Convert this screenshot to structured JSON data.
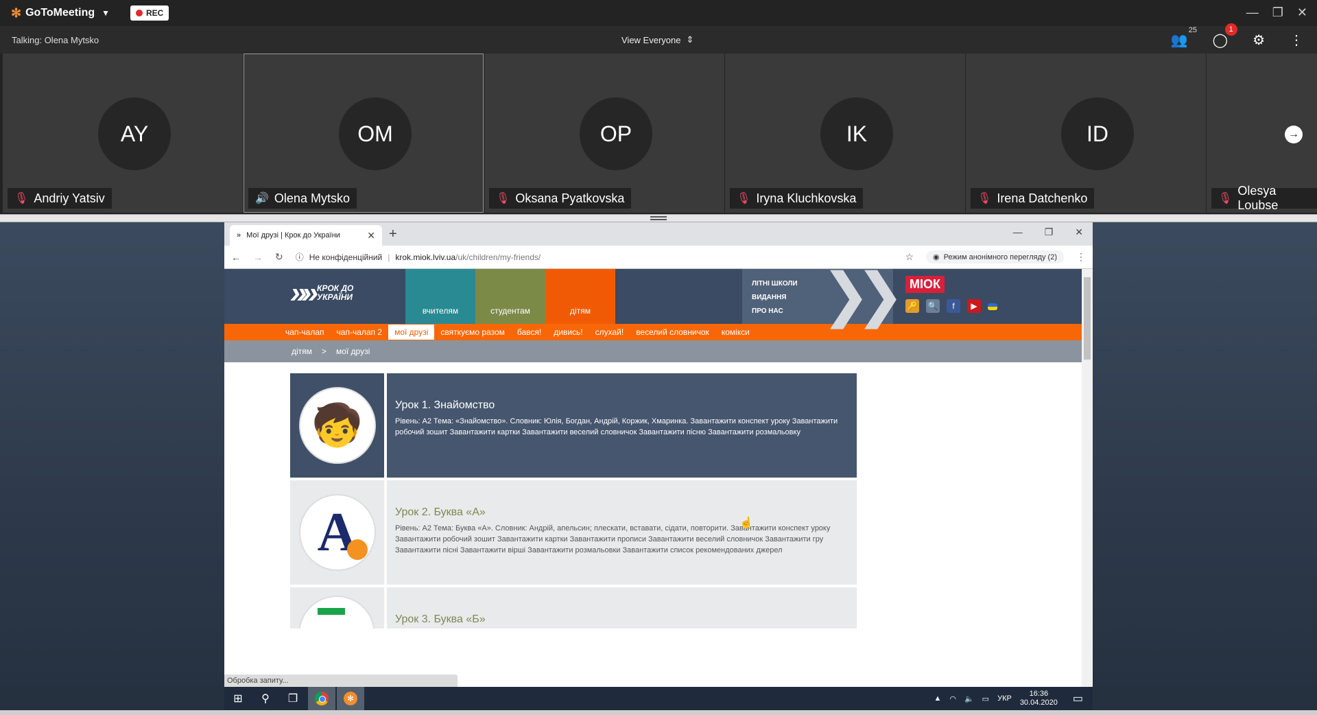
{
  "goto": {
    "brand": "GoToMeeting",
    "rec_label": "REC",
    "talking": "Talking: Olena Mytsko",
    "view_selector": "View Everyone",
    "attendee_count": "25",
    "chat_badge": "1"
  },
  "participants": [
    {
      "initials": "AY",
      "name": "Andriy Yatsiv",
      "mic": "muted"
    },
    {
      "initials": "OM",
      "name": "Olena Mytsko",
      "mic": "speaking"
    },
    {
      "initials": "OP",
      "name": "Oksana Pyatkovska",
      "mic": "muted"
    },
    {
      "initials": "IK",
      "name": "Iryna Kluchkovska",
      "mic": "muted"
    },
    {
      "initials": "ID",
      "name": "Irena Datchenko",
      "mic": "muted"
    },
    {
      "initials": "",
      "name": "Olesya Loubse",
      "mic": "muted"
    }
  ],
  "browser": {
    "tab_title": "Мої друзі | Крок до України",
    "not_secure": "Не конфіденційний",
    "url_domain": "krok.miok.lviv.ua",
    "url_path": "/uk/children/my-friends/",
    "incognito": "Режим анонімного перегляду (2)",
    "status": "Обробка запиту..."
  },
  "site": {
    "logo_text": "КРОК ДО УКРАЇНИ",
    "sections": [
      "вчителям",
      "студентам",
      "дітям"
    ],
    "header_links": [
      "ЛІТНІ ШКОЛИ",
      "ВИДАННЯ",
      "ПРО НАС"
    ],
    "miok": "МІОК",
    "menu": [
      "чап-чалап",
      "чап-чалап 2",
      "мої друзі",
      "святкуємо разом",
      "бався!",
      "дивись!",
      "слухай!",
      "веселий словничок",
      "комікси"
    ],
    "active_menu": "мої друзі",
    "breadcrumb": [
      "дітям",
      ">",
      "мої друзі"
    ],
    "lessons": [
      {
        "title": "Урок 1. Знайомство",
        "desc": "Рівень: А2 Тема: «Знайомство». Словник: Юлія, Богдан, Андрій, Коржик, Хмаринка. Завантажити конспект уроку Завантажити робочий зошит Завантажити картки Завантажити веселий словничок Завантажити пісню Завантажити розмальовку"
      },
      {
        "title": "Урок 2. Буква «А»",
        "desc": "Рівень: А2 Тема: Буква «А». Словник: Андрій, апельсин; плескати, вставати, сідати, повторити. Завантажити конспект уроку Завантажити робочий зошит Завантажити картки Завантажити прописи Завантажити веселий словничок Завантажити гру Завантажити пісні Завантажити вірші Завантажити розмальовки Завантажити список рекомендованих джерел"
      },
      {
        "title": "Урок 3. Буква «Б»"
      }
    ]
  },
  "taskbar": {
    "lang": "УКР",
    "time": "16:36",
    "date": "30.04.2020"
  },
  "colors": {
    "teachers": "#2a8a93",
    "students": "#7c8a48",
    "children": "#f15a05",
    "menu_bar": "#f86707",
    "header": "#3a4b63"
  }
}
